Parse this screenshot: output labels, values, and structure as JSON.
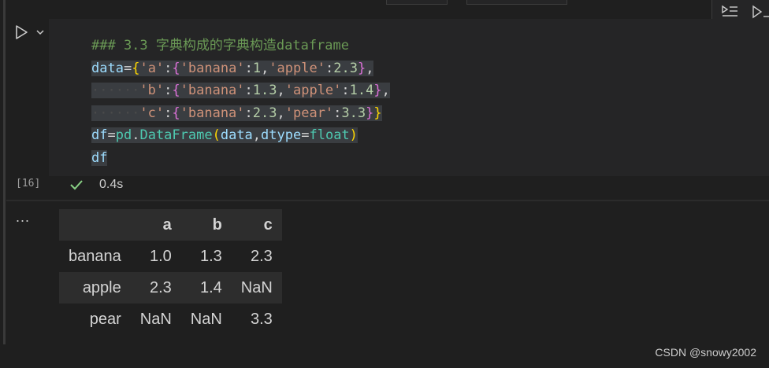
{
  "cell": {
    "code_lines": [
      [
        {
          "t": "### 3.3 字典构成的字典构造dataframe",
          "c": "c-com"
        }
      ],
      [
        {
          "t": "data",
          "c": "c-var"
        },
        {
          "t": "=",
          "c": "c-op"
        },
        {
          "t": "{",
          "c": "c-b1"
        },
        {
          "t": "'a'",
          "c": "c-str"
        },
        {
          "t": ":",
          "c": "c-op"
        },
        {
          "t": "{",
          "c": "c-b2"
        },
        {
          "t": "'banana'",
          "c": "c-str"
        },
        {
          "t": ":",
          "c": "c-op"
        },
        {
          "t": "1",
          "c": "c-num"
        },
        {
          "t": ",",
          "c": "c-op"
        },
        {
          "t": "'apple'",
          "c": "c-str"
        },
        {
          "t": ":",
          "c": "c-op"
        },
        {
          "t": "2.3",
          "c": "c-num"
        },
        {
          "t": "}",
          "c": "c-b2"
        },
        {
          "t": ",",
          "c": "c-op"
        }
      ],
      [
        {
          "t": "······",
          "c": "c-ws"
        },
        {
          "t": "'b'",
          "c": "c-str"
        },
        {
          "t": ":",
          "c": "c-op"
        },
        {
          "t": "{",
          "c": "c-b2"
        },
        {
          "t": "'banana'",
          "c": "c-str"
        },
        {
          "t": ":",
          "c": "c-op"
        },
        {
          "t": "1.3",
          "c": "c-num"
        },
        {
          "t": ",",
          "c": "c-op"
        },
        {
          "t": "'apple'",
          "c": "c-str"
        },
        {
          "t": ":",
          "c": "c-op"
        },
        {
          "t": "1.4",
          "c": "c-num"
        },
        {
          "t": "}",
          "c": "c-b2"
        },
        {
          "t": ",",
          "c": "c-op"
        }
      ],
      [
        {
          "t": "······",
          "c": "c-ws"
        },
        {
          "t": "'c'",
          "c": "c-str"
        },
        {
          "t": ":",
          "c": "c-op"
        },
        {
          "t": "{",
          "c": "c-b2"
        },
        {
          "t": "'banana'",
          "c": "c-str"
        },
        {
          "t": ":",
          "c": "c-op"
        },
        {
          "t": "2.3",
          "c": "c-num"
        },
        {
          "t": ",",
          "c": "c-op"
        },
        {
          "t": "'pear'",
          "c": "c-str"
        },
        {
          "t": ":",
          "c": "c-op"
        },
        {
          "t": "3.3",
          "c": "c-num"
        },
        {
          "t": "}",
          "c": "c-b2"
        },
        {
          "t": "}",
          "c": "c-b1"
        }
      ],
      [
        {
          "t": "df",
          "c": "c-var"
        },
        {
          "t": "=",
          "c": "c-op"
        },
        {
          "t": "pd",
          "c": "c-cls"
        },
        {
          "t": ".",
          "c": "c-op"
        },
        {
          "t": "DataFrame",
          "c": "c-cls"
        },
        {
          "t": "(",
          "c": "c-b1"
        },
        {
          "t": "data",
          "c": "c-var"
        },
        {
          "t": ",",
          "c": "c-op"
        },
        {
          "t": "dtype",
          "c": "c-var"
        },
        {
          "t": "=",
          "c": "c-op"
        },
        {
          "t": "float",
          "c": "c-cls"
        },
        {
          "t": ")",
          "c": "c-b1"
        }
      ],
      [
        {
          "t": "df",
          "c": "c-var"
        }
      ]
    ],
    "execution_count": "[16]",
    "duration": "0.4s"
  },
  "output": {
    "menu": "...",
    "columns": [
      "a",
      "b",
      "c"
    ],
    "rows": [
      {
        "index": "banana",
        "values": [
          "1.0",
          "1.3",
          "2.3"
        ]
      },
      {
        "index": "apple",
        "values": [
          "2.3",
          "1.4",
          "NaN"
        ]
      },
      {
        "index": "pear",
        "values": [
          "NaN",
          "NaN",
          "3.3"
        ]
      }
    ]
  },
  "icons": {
    "run": "run-cell-icon",
    "chevron": "chevron-down-icon",
    "check": "check-icon",
    "toolbar": [
      "execute-above-icon",
      "execute-below-icon"
    ]
  },
  "colors": {
    "success": "#89d185",
    "selection": "#3a3d41"
  },
  "watermark": "CSDN @snowy2002"
}
